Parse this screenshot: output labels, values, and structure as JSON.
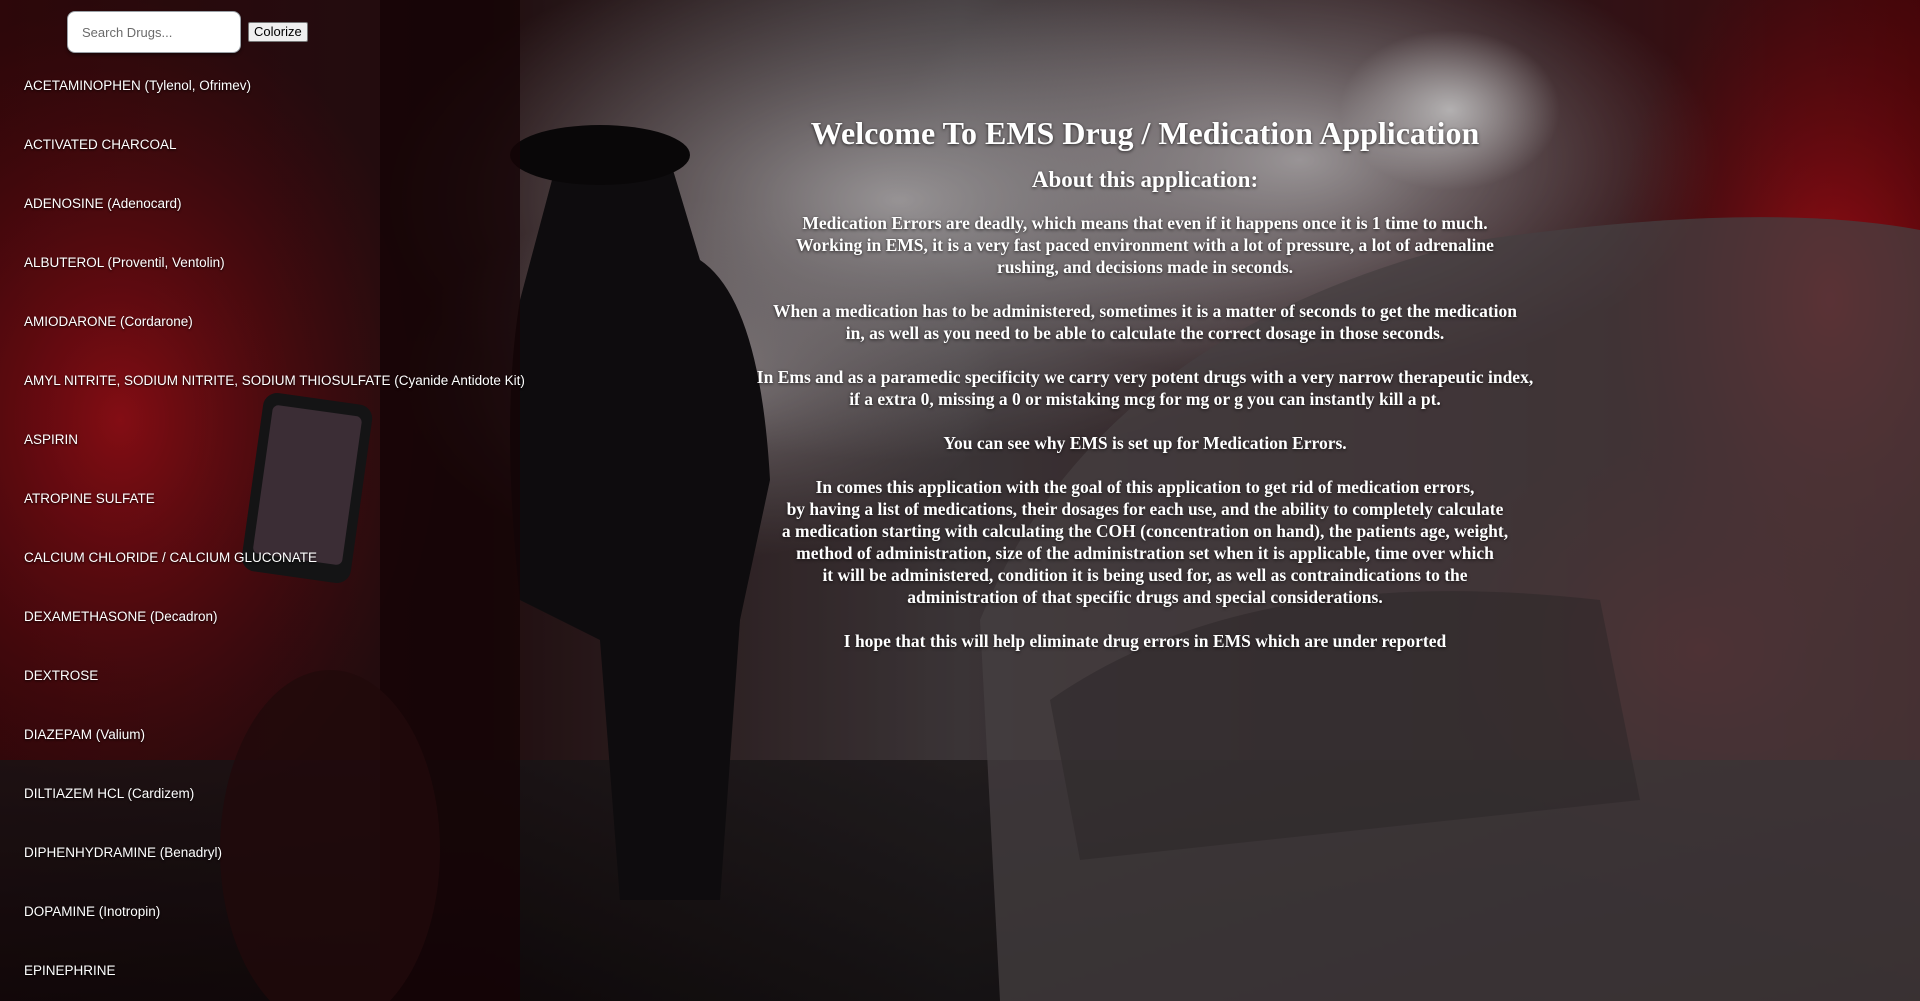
{
  "search": {
    "placeholder": "Search Drugs..."
  },
  "toolbar": {
    "colorize_label": "Colorize"
  },
  "drugs": [
    "ACETAMINOPHEN (Tylenol, Ofrimev)",
    "ACTIVATED CHARCOAL",
    "ADENOSINE (Adenocard)",
    "ALBUTEROL (Proventil, Ventolin)",
    "AMIODARONE (Cordarone)",
    "AMYL NITRITE, SODIUM NITRITE, SODIUM THIOSULFATE (Cyanide Antidote Kit)",
    "ASPIRIN",
    "ATROPINE SULFATE",
    "CALCIUM CHLORIDE / CALCIUM GLUCONATE",
    "DEXAMETHASONE (Decadron)",
    "DEXTROSE",
    "DIAZEPAM (Valium)",
    "DILTIAZEM HCL (Cardizem)",
    "DIPHENHYDRAMINE (Benadryl)",
    "DOPAMINE (Inotropin)",
    "EPINEPHRINE"
  ],
  "main": {
    "title": "Welcome To EMS Drug / Medication Application",
    "subtitle": "About this application:",
    "paragraphs": [
      [
        "Medication Errors are deadly, which means that even if it happens once it is 1 time to much.",
        "Working in EMS, it is a very fast paced environment with a lot of pressure, a lot of adrenaline",
        "rushing, and decisions made in seconds."
      ],
      [
        "When a medication has to be administered, sometimes it is a matter of seconds to get the medication",
        "in, as well as you need to be able to calculate the correct dosage in those seconds."
      ],
      [
        "In Ems and as a paramedic specificity we carry very potent drugs with a very narrow therapeutic index,",
        "if a extra 0, missing a 0 or mistaking mcg for mg or g you can instantly kill a pt."
      ],
      [
        "You can see why EMS is set up for Medication Errors."
      ],
      [
        "In comes this application with the goal of this application to get rid of medication errors,",
        "by having a list of medications, their dosages for each use, and the ability to completely calculate",
        "a medication starting with calculating the COH (concentration on hand), the patients age, weight,",
        "method of administration, size of the administration set when it is applicable, time over which",
        "it will be administered, condition it is being used for, as well as contraindications to the",
        "administration of that specific drugs and special considerations."
      ],
      [
        "I hope that this will help eliminate drug errors in EMS which are under reported"
      ]
    ]
  }
}
